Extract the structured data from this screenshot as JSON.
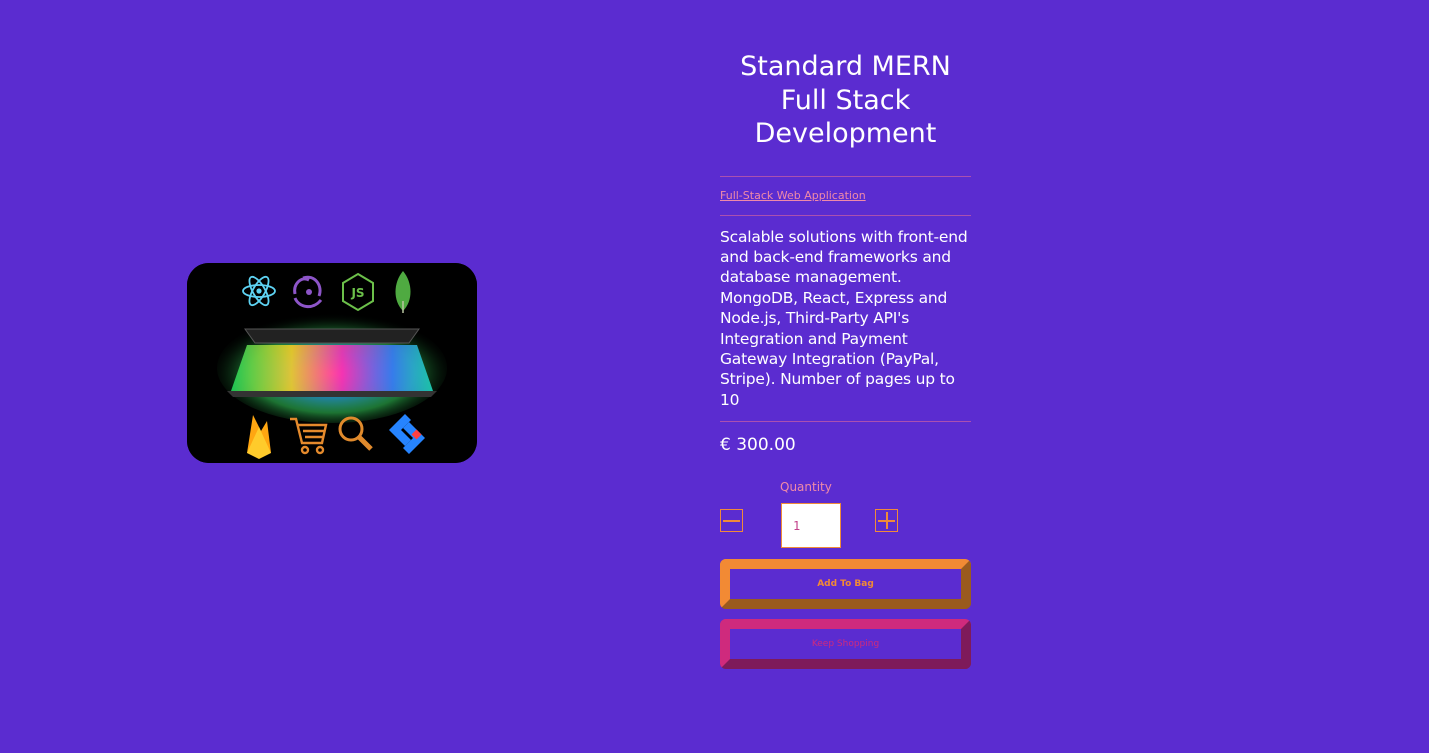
{
  "product": {
    "title": "Standard MERN Full Stack Development",
    "category_link": "Full-Stack Web Application",
    "description": "Scalable solutions with front-end and back-end frameworks and database management. MongoDB, React, Express and Node.js, Third-Party API's Integration and Payment Gateway Integration (PayPal, Stripe). Number of pages up to 10",
    "price": "€ 300.00"
  },
  "quantity": {
    "label": "Quantity",
    "value": "1"
  },
  "actions": {
    "add_to_bag": "Add To Bag",
    "keep_shopping": "Keep Shopping"
  },
  "image": {
    "icons": [
      "react-icon",
      "redux-icon",
      "nodejs-icon",
      "mongodb-icon",
      "firebase-icon",
      "cart-icon",
      "search-icon",
      "jira-icon"
    ],
    "node_badge": "JS"
  },
  "colors": {
    "background": "#5b2cd0",
    "accent_orange": "#f28a34",
    "accent_pink": "#cf2a7d",
    "link_pink": "#f08aa8"
  }
}
